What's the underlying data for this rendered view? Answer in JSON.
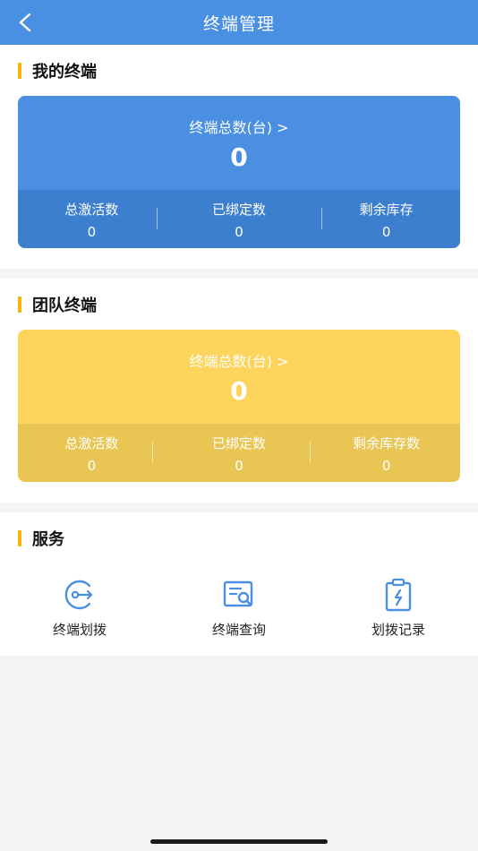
{
  "navbar": {
    "title": "终端管理",
    "back_icon": "chevron-left-icon"
  },
  "my_terminals": {
    "heading": "我的终端",
    "total_label": "终端总数(台) >",
    "total_value": "0",
    "stats": [
      {
        "label": "总激活数",
        "value": "0"
      },
      {
        "label": "已绑定数",
        "value": "0"
      },
      {
        "label": "剩余库存",
        "value": "0"
      }
    ]
  },
  "team_terminals": {
    "heading": "团队终端",
    "total_label": "终端总数(台) >",
    "total_value": "0",
    "stats": [
      {
        "label": "总激活数",
        "value": "0"
      },
      {
        "label": "已绑定数",
        "value": "0"
      },
      {
        "label": "剩余库存数",
        "value": "0"
      }
    ]
  },
  "services": {
    "heading": "服务",
    "items": [
      {
        "label": "终端划拨",
        "icon": "transfer-icon"
      },
      {
        "label": "终端查询",
        "icon": "search-document-icon"
      },
      {
        "label": "划拨记录",
        "icon": "clipboard-record-icon"
      }
    ]
  },
  "colors": {
    "brand_blue": "#4a90e2",
    "accent_yellow": "#f5b800",
    "team_card": "#fdd45c"
  }
}
